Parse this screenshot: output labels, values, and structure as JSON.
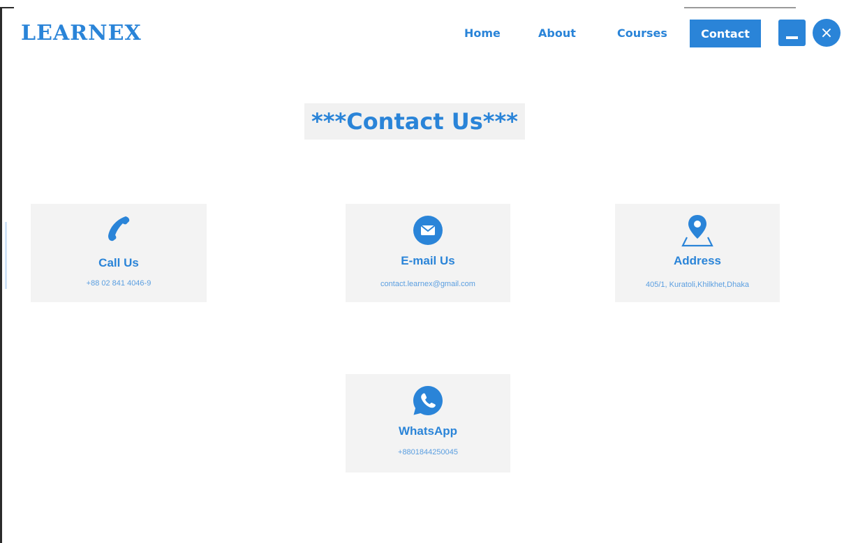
{
  "header": {
    "logo": "LEARNEX",
    "nav": [
      {
        "label": "Home"
      },
      {
        "label": "About"
      },
      {
        "label": "Courses"
      },
      {
        "label": "Contact"
      }
    ],
    "window_controls": {
      "minimize_icon": "minimize-icon",
      "close_icon": "close-icon",
      "close_glyph": "×"
    }
  },
  "main": {
    "title": "***Contact Us***",
    "cards": [
      {
        "label": "Call Us",
        "detail": "+88 02 841 4046-9",
        "icon": "phone-icon"
      },
      {
        "label": "E-mail Us",
        "detail": "contact.learnex@gmail.com",
        "icon": "envelope-icon"
      },
      {
        "label": "Address",
        "detail": "405/1, Kuratoli,Khilkhet,Dhaka",
        "icon": "map-pin-icon"
      },
      {
        "label": "WhatsApp",
        "detail": "+8801844250045",
        "icon": "whatsapp-icon"
      }
    ]
  },
  "colors": {
    "accent": "#2a84d8",
    "card_bg": "#f3f3f3",
    "title_bg": "#f1f1f1"
  }
}
